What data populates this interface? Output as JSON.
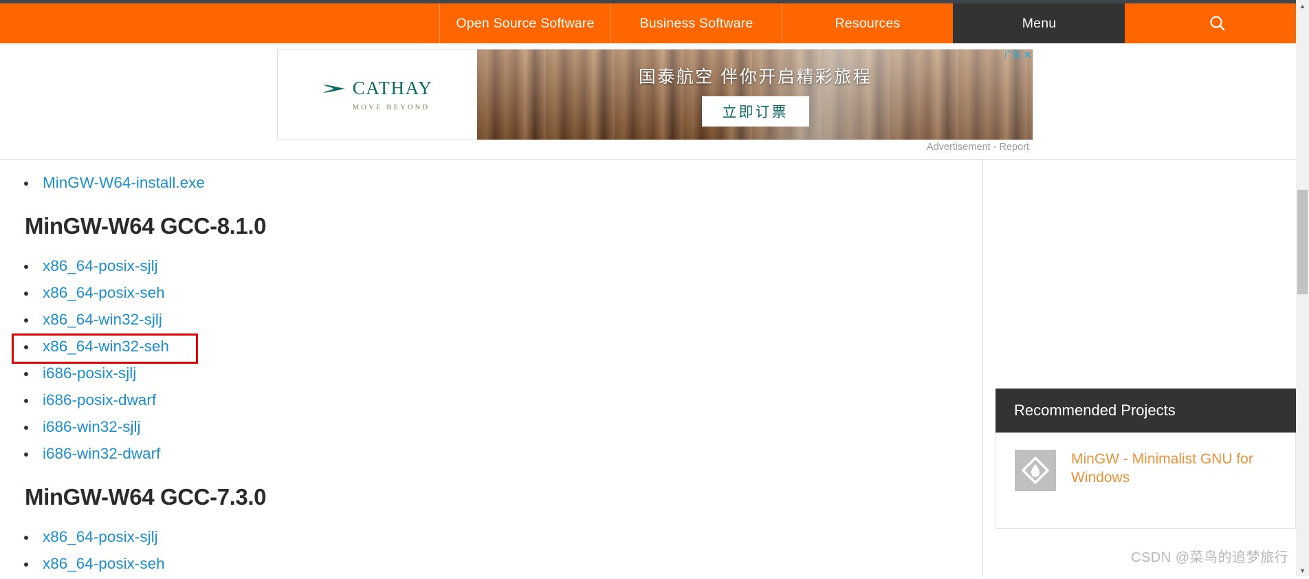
{
  "nav": {
    "items": [
      {
        "label": "Open Source Software",
        "active": false
      },
      {
        "label": "Business Software",
        "active": false
      },
      {
        "label": "Resources",
        "active": false
      },
      {
        "label": "Menu",
        "active": true
      }
    ],
    "search_icon": "search-icon"
  },
  "ad": {
    "brand": "CATHAY",
    "tagline": "MOVE BEYOND",
    "headline": "国泰航空 伴你开启精彩旅程",
    "cta": "立即订票",
    "badge_label": "广告",
    "close_label": "✕",
    "note": "Advertisement - Report"
  },
  "main": {
    "top_link": "MinGW-W64-install.exe",
    "sections": [
      {
        "heading": "MinGW-W64 GCC-8.1.0",
        "links": [
          "x86_64-posix-sjlj",
          "x86_64-posix-seh",
          "x86_64-win32-sjlj",
          "x86_64-win32-seh",
          "i686-posix-sjlj",
          "i686-posix-dwarf",
          "i686-win32-sjlj",
          "i686-win32-dwarf"
        ],
        "highlighted_index": 3
      },
      {
        "heading": "MinGW-W64 GCC-7.3.0",
        "links": [
          "x86_64-posix-sjlj",
          "x86_64-posix-seh"
        ],
        "highlighted_index": -1
      }
    ]
  },
  "rail": {
    "card_title": "Recommended Projects",
    "project": {
      "name": "MinGW - Minimalist GNU for Windows",
      "thumb_icon": "mingw-diamond-flame-icon"
    }
  },
  "watermark": "CSDN @菜鸟的追梦旅行",
  "colors": {
    "brand_orange": "#ff6600",
    "menu_dark": "#333333",
    "link_blue": "#1a8fd0",
    "highlight_red": "#e60000",
    "project_orange": "#e8923a",
    "cathay_teal": "#0b6b63"
  }
}
